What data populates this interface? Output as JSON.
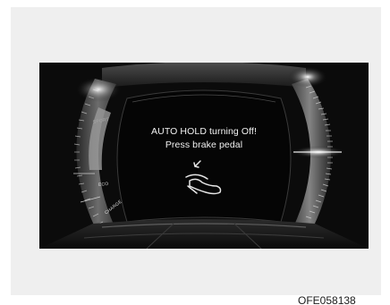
{
  "message": {
    "line1": "AUTO HOLD turning Off!",
    "line2": "Press brake pedal"
  },
  "modes": {
    "sport": "SPORT",
    "eco": "ECO",
    "charge": "CHARGE"
  },
  "icon": "foot-on-brake-pedal-icon",
  "image_code": "OFE058138"
}
